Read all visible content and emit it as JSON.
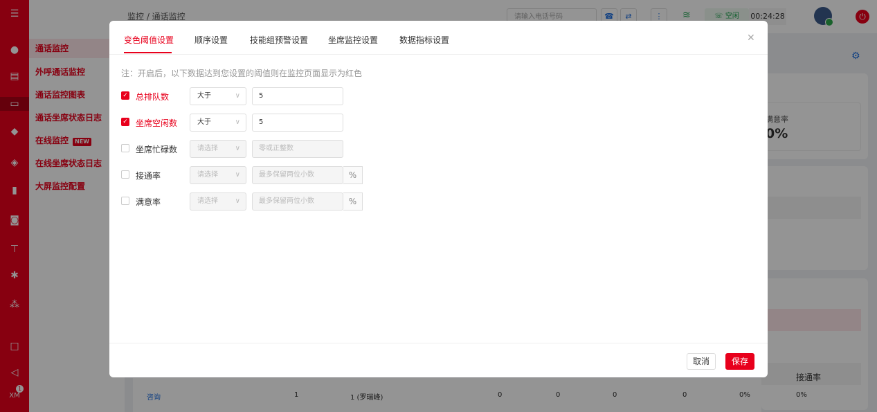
{
  "rail": {
    "badge": "1",
    "user_label": "XM"
  },
  "sidebar": {
    "items": [
      {
        "label": "通话监控"
      },
      {
        "label": "外呼通话监控"
      },
      {
        "label": "通话监控图表"
      },
      {
        "label": "通话坐席状态日志"
      },
      {
        "label": "在线监控",
        "badge": "NEW"
      },
      {
        "label": "在线坐席状态日志"
      },
      {
        "label": "大屏监控配置"
      }
    ]
  },
  "topbar": {
    "breadcrumb": "监控 / 通话监控",
    "search_placeholder": "请输入电话号码",
    "status": "空闲",
    "timer": "00:24:28"
  },
  "background": {
    "satisfaction_label": "满意率",
    "satisfaction_value": "0%",
    "table_row": {
      "skill": "咨询",
      "c1": "1",
      "c2": "1 (罗瑞峰)",
      "c3": "0",
      "c4": "0",
      "c5": "0",
      "c6": "0",
      "c7": "0%",
      "c8": "0%"
    },
    "table_header_last": "接通率"
  },
  "modal": {
    "tabs": [
      {
        "label": "变色阈值设置"
      },
      {
        "label": "顺序设置"
      },
      {
        "label": "技能组预警设置"
      },
      {
        "label": "坐席监控设置"
      },
      {
        "label": "数据指标设置"
      }
    ],
    "note": "注：开启后，以下数据达到您设置的阈值则在监控页面显示为红色",
    "rows": [
      {
        "label": "总排队数",
        "checked": true,
        "operator": "大于",
        "value": "5"
      },
      {
        "label": "坐席空闲数",
        "checked": true,
        "operator": "大于",
        "value": "5"
      },
      {
        "label": "坐席忙碌数",
        "checked": false,
        "operator_placeholder": "请选择",
        "value_placeholder": "零或正整数"
      },
      {
        "label": "接通率",
        "checked": false,
        "operator_placeholder": "请选择",
        "value_placeholder": "最多保留两位小数",
        "unit": "%"
      },
      {
        "label": "满意率",
        "checked": false,
        "operator_placeholder": "请选择",
        "value_placeholder": "最多保留两位小数",
        "unit": "%"
      }
    ],
    "cancel_label": "取消",
    "save_label": "保存"
  },
  "colors": {
    "brand": "#e8001c",
    "overlay": "rgba(0,0,0,0.42)"
  }
}
